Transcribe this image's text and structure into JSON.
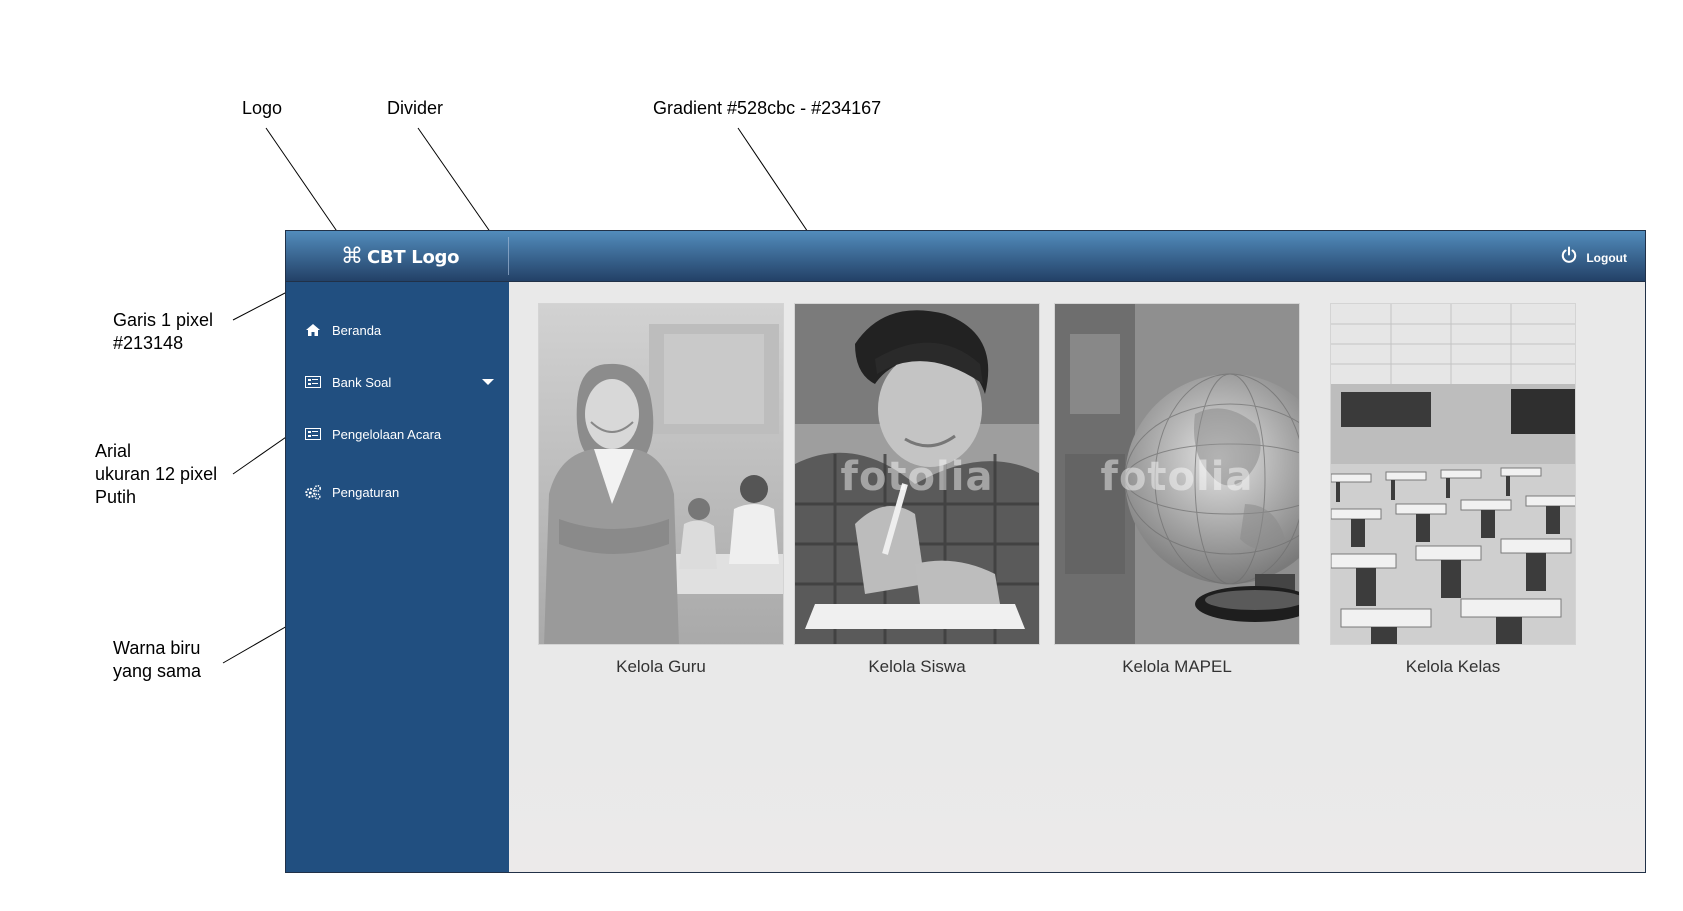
{
  "annotations": {
    "logo": "Logo",
    "divider": "Divider",
    "gradient": "Gradient #528cbc - #234167",
    "border_line": "Garis 1 pixel\n#213148",
    "font_note": "Arial\nukuran 12 pixel\nPutih",
    "sidebar_color": "Warna biru\nyang sama"
  },
  "header": {
    "logo_icon": "⌘",
    "logo_text": "CBT Logo",
    "logout_label": "Logout"
  },
  "sidebar": {
    "items": [
      {
        "label": "Beranda",
        "icon": "home-icon"
      },
      {
        "label": "Bank Soal",
        "icon": "list-icon",
        "has_dropdown": true
      },
      {
        "label": "Pengelolaan Acara",
        "icon": "list-icon"
      },
      {
        "label": "Pengaturan",
        "icon": "gears-icon"
      }
    ]
  },
  "cards": [
    {
      "label": "Kelola Guru",
      "image": "teacher-photo"
    },
    {
      "label": "Kelola Siswa",
      "image": "student-photo",
      "watermark": "fotolia"
    },
    {
      "label": "Kelola MAPEL",
      "image": "globe-photo",
      "watermark": "fotolia"
    },
    {
      "label": "Kelola Kelas",
      "image": "classroom-photo"
    }
  ],
  "colors": {
    "gradient_top": "#528cbc",
    "gradient_bottom": "#234167",
    "border": "#213148",
    "sidebar": "#214f80",
    "content_bg": "#e9e9e9"
  }
}
